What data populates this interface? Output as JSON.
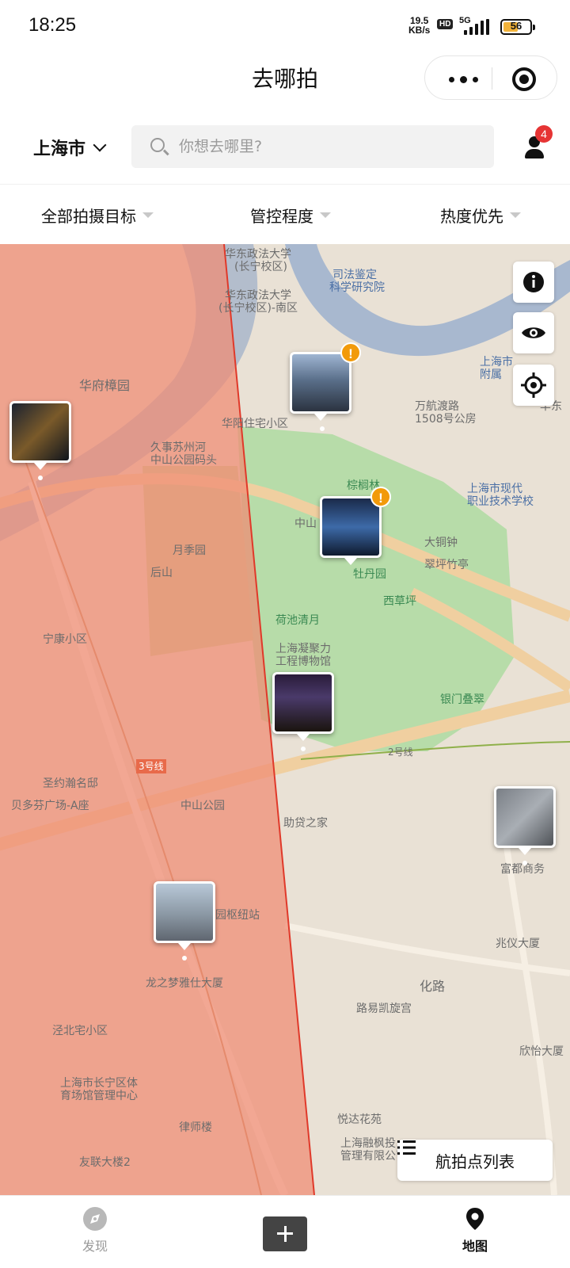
{
  "status_bar": {
    "time": "18:25",
    "net_speed_value": "19.5",
    "net_speed_unit": "KB/s",
    "hd_label": "HD",
    "network_label": "5G",
    "battery_level": "56",
    "battery_color": "#f2b33b"
  },
  "header": {
    "title": "去哪拍"
  },
  "search_row": {
    "city": "上海市",
    "search_placeholder": "你想去哪里?",
    "notification_count": "4"
  },
  "filters": [
    {
      "label": "全部拍摄目标"
    },
    {
      "label": "管控程度"
    },
    {
      "label": "热度优先"
    }
  ],
  "map": {
    "restricted_zone_color": "#f08a73",
    "park_color": "#a9d7a0",
    "river_color": "#a8b8cf",
    "pois": [
      "华东政法大学",
      "(长宁校区)",
      "司法鉴定",
      "科学研究院",
      "华东政法大学",
      "(长宁校区)-南区",
      "华府樟园",
      "华阳住宅小区",
      "久事苏州河",
      "中山公园码头",
      "万航渡路",
      "1508号公房",
      "上海市",
      "附属",
      "华东",
      "棕榈林",
      "上海市现代",
      "职业技术学校",
      "中山",
      "月季园",
      "后山",
      "大铜钟",
      "翠坪竹亭",
      "牡丹园",
      "西草坪",
      "荷池清月",
      "宁康小区",
      "上海凝聚力",
      "工程博物馆",
      "银门叠翠",
      "2号线",
      "3号线",
      "圣约瀚名邸",
      "贝多芬广场-A座",
      "中山公园",
      "助贷之家",
      "富都商务",
      "园枢纽站",
      "龙之梦雅仕大厦",
      "兆仪大厦",
      "化路",
      "路易凯旋宫",
      "泾北宅小区",
      "欣怡大厦",
      "上海市长宁区体",
      "育场馆管理中心",
      "悦达花苑",
      "律师楼",
      "上海融枫投",
      "管理有限公司",
      "友联大楼2"
    ],
    "list_button_label": "航拍点列表"
  },
  "tabs": [
    {
      "label": "发现"
    },
    {
      "label": "地图"
    }
  ]
}
